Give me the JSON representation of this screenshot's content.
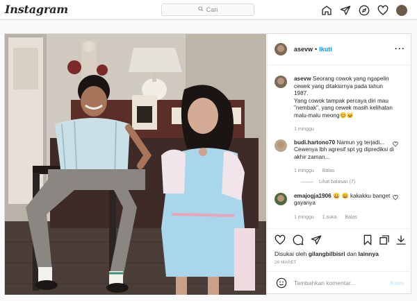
{
  "nav": {
    "logo": "Instagram",
    "search_placeholder": "Cari",
    "icons": [
      "home-icon",
      "direct-icon",
      "explore-icon",
      "activity-heart-icon",
      "profile-avatar"
    ]
  },
  "post": {
    "username": "asevw",
    "separator": "•",
    "follow_label": "Ikuti",
    "more_label": "···",
    "comments": [
      {
        "username": "asevw",
        "text": "Seorang cowok yang ngapelin cewek yang ditaksirnya pada tahun 1987.",
        "text2": "Yang cowok tampak percaya diri mau \"nembak\", yang cewek masih kelihatan malu-malu meong😊🐱",
        "time": "1 minggu"
      },
      {
        "username": "budi.hartono70",
        "text": "Namun yg terjadi... Cewenya lbh agresif spt yg diprediksi di akhir zaman...",
        "time": "1 minggu",
        "reply_label": "Balas",
        "view_replies": "Lihat balasan (7)"
      },
      {
        "username": "emajogja1906",
        "text": "😀 😀 kakakku banget gayanya",
        "time": "1 minggu",
        "likes": "1 suka",
        "reply_label": "Balas"
      }
    ],
    "liked_prefix": "Disukai oleh",
    "liked_user": "gilangbilbisri",
    "liked_and": "dan",
    "liked_others": "lainnya",
    "date": "26 MARET",
    "comment_placeholder": "Tambahkan komentar...",
    "post_label": "Kirim"
  },
  "colors": {
    "accent": "#0095f6",
    "post_disabled": "#b2dffc",
    "border": "#dbdbdb",
    "muted": "#8e8e8e"
  }
}
